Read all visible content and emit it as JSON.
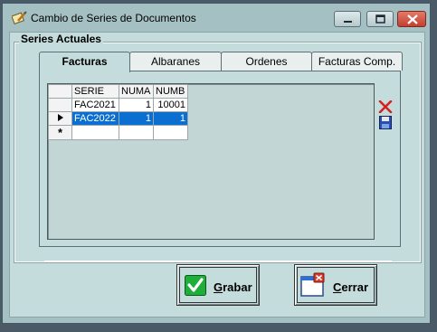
{
  "window": {
    "title": "Cambio de Series de Documentos"
  },
  "group": {
    "label": "Series Actuales"
  },
  "tabs": [
    {
      "label": "Facturas",
      "active": true
    },
    {
      "label": "Albaranes",
      "active": false
    },
    {
      "label": "Ordenes",
      "active": false
    },
    {
      "label": "Facturas Comp.",
      "active": false
    }
  ],
  "grid": {
    "columns": [
      "SERIE",
      "NUMA",
      "NUMB"
    ],
    "rows": [
      {
        "serie": "FAC2021",
        "numa": "1",
        "numb": "10001",
        "selected": false
      },
      {
        "serie": "FAC2022",
        "numa": "1",
        "numb": "1",
        "selected": true
      }
    ],
    "new_row_marker": "*"
  },
  "buttons": {
    "grabar_underlined": "G",
    "grabar_rest": "rabar",
    "cerrar_underlined": "C",
    "cerrar_rest": "errar"
  },
  "colors": {
    "selection": "#0a6fd0",
    "delete_icon": "#d42020",
    "close_button": "#c2402f"
  },
  "icons": {
    "title": "pencil-note-icon",
    "delete": "red-x-icon",
    "save": "floppy-disk-icon",
    "grabar": "green-check-icon",
    "cerrar": "close-window-icon"
  }
}
